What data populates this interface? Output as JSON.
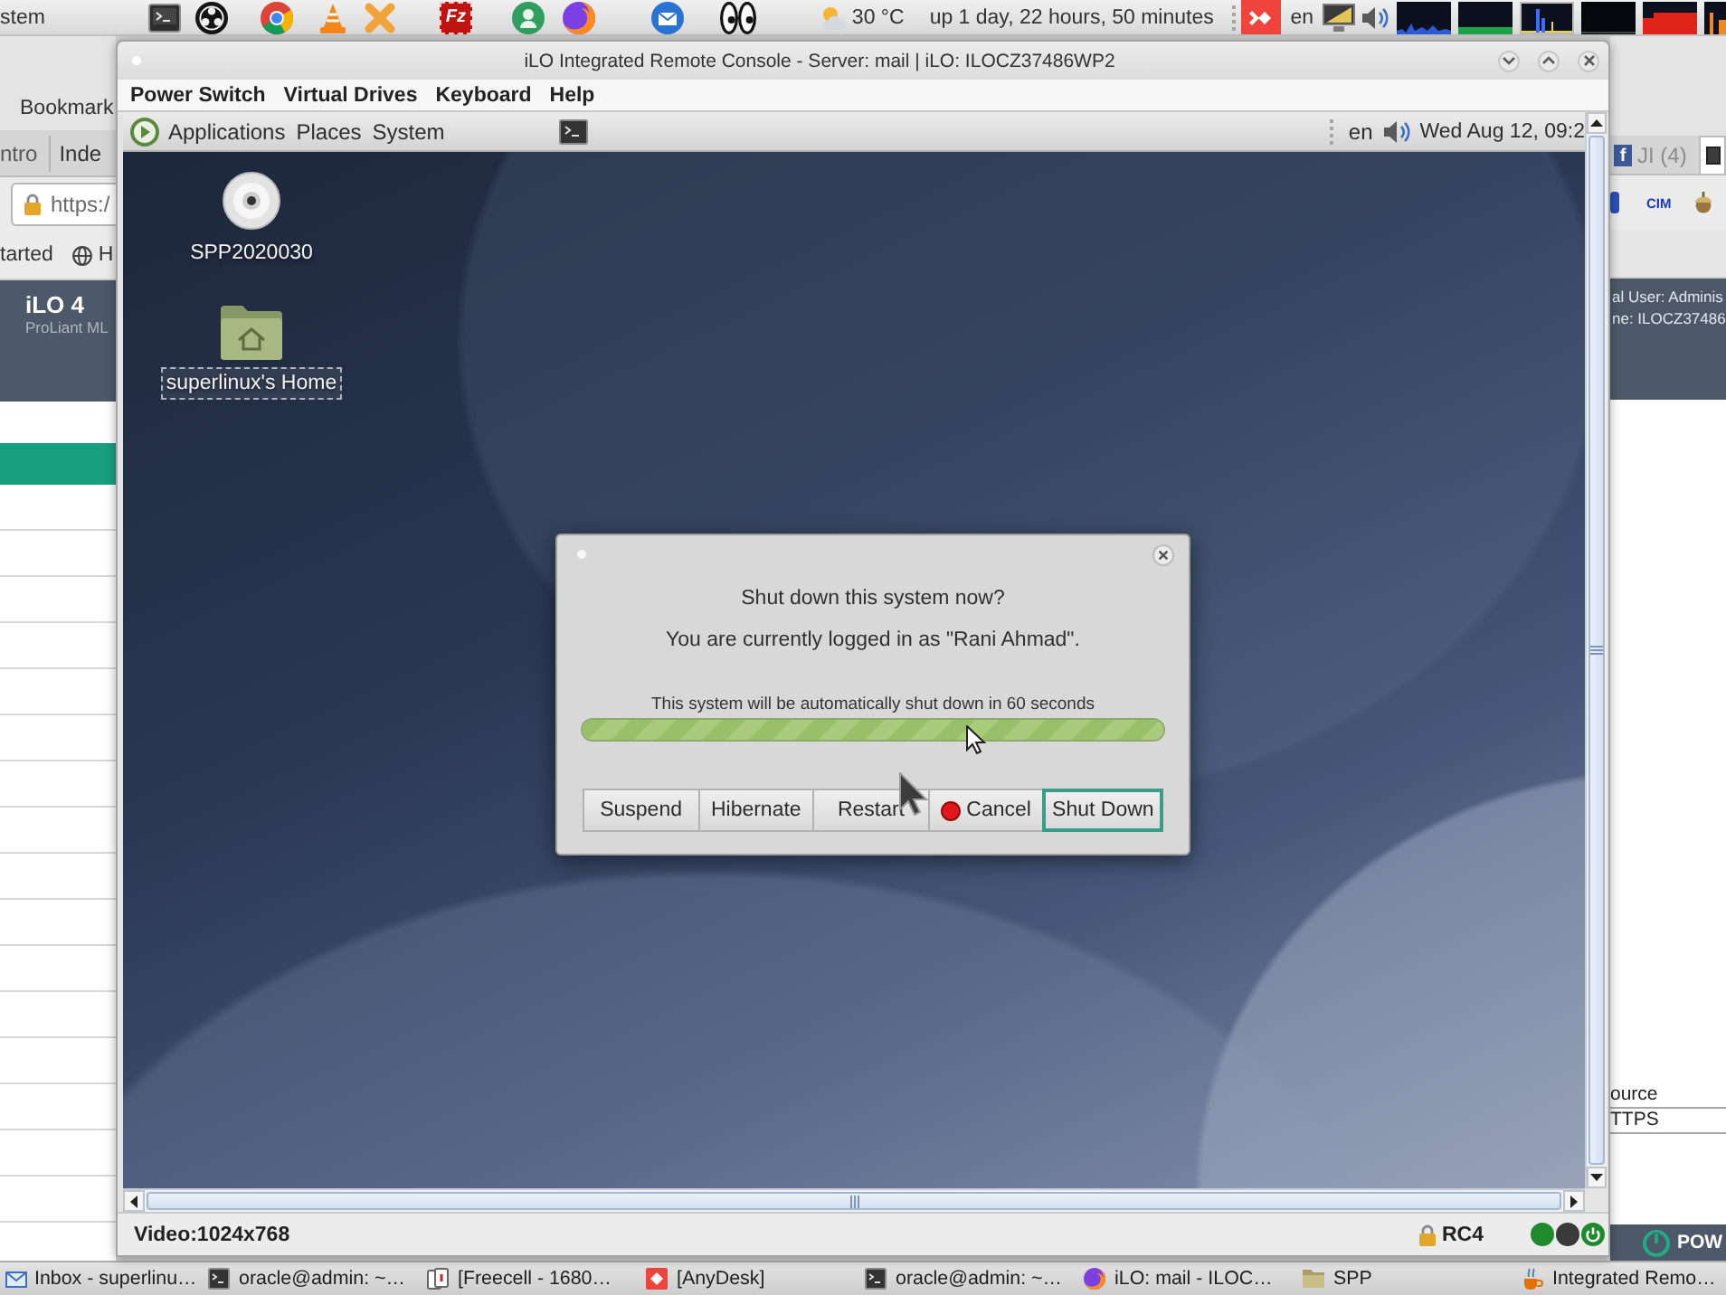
{
  "top_panel": {
    "menu": "stem",
    "launcher_label": "Fz",
    "weather": "30 °C",
    "uptime": "up 1 day, 22 hours, 50 minutes",
    "keyboard_layout": "en"
  },
  "browser": {
    "menu": "Bookmark",
    "tabs": [
      {
        "label": "ntro",
        "selected": false
      },
      {
        "label": "Inde",
        "selected": false
      }
    ],
    "address": "https:/",
    "bookmarks": [
      {
        "label": "tarted",
        "kind": "plain"
      },
      {
        "label": "H",
        "kind": "globe"
      }
    ],
    "header_title": "iLO 4",
    "header_subtitle": "ProLiant ML",
    "right_tabs": [
      {
        "label": "JI (4)",
        "favicon": "f",
        "selected": false
      },
      {
        "selected": true
      }
    ],
    "toolbar_label": "CIM",
    "header_lines": [
      "al User: Adminis",
      "ne: ILOCZ37486"
    ],
    "table_rows": [
      "ource",
      "TTPS"
    ],
    "power_label": "POW"
  },
  "console": {
    "title": "iLO Integrated Remote Console - Server: mail | iLO: ILOCZ37486WP2",
    "menu": [
      "Power Switch",
      "Virtual Drives",
      "Keyboard",
      "Help"
    ],
    "guest_panel": {
      "menus": [
        "Applications",
        "Places",
        "System"
      ],
      "keyboard_layout": "en",
      "clock": "Wed Aug 12, 09:2"
    },
    "desktop_icons": [
      {
        "label": "SPP2020030",
        "kind": "disc",
        "selected": false
      },
      {
        "label": "superlinux's Home",
        "kind": "home-folder",
        "selected": true
      }
    ],
    "dialog": {
      "title": "Shut down this system now?",
      "message": "You are currently logged in as \"Rani Ahmad\".",
      "countdown": {
        "text": "This system will be automatically shut down in 60 seconds",
        "level": 1
      },
      "buttons": [
        {
          "label": "Suspend",
          "kind": "plain",
          "focused": false
        },
        {
          "label": "Hibernate",
          "kind": "plain",
          "focused": false
        },
        {
          "label": "Restart",
          "kind": "plain",
          "focused": false
        },
        {
          "label": "Cancel",
          "kind": "stop",
          "focused": false
        },
        {
          "label": "Shut Down",
          "kind": "plain",
          "focused": true
        }
      ]
    },
    "status": {
      "video": "Video:1024x768",
      "encryption": "RC4",
      "indicators": [
        {
          "kind": "dot",
          "color": "#1e8a2c"
        },
        {
          "kind": "dot",
          "color": "#3a3a3a"
        },
        {
          "kind": "power",
          "color": "#1e8a2c"
        }
      ]
    }
  },
  "taskbar": [
    {
      "label": "Inbox - superlinu…",
      "kind": "mail"
    },
    {
      "label": "oracle@admin: ~…",
      "kind": "terminal"
    },
    {
      "label": "[Freecell - 1680…",
      "kind": "cards"
    },
    {
      "label": "[AnyDesk]",
      "kind": "remote"
    },
    {
      "label": "oracle@admin: ~…",
      "kind": "terminal"
    },
    {
      "label": "iLO: mail - ILOC…",
      "kind": "browser"
    },
    {
      "label": "SPP",
      "kind": "folder"
    },
    {
      "label": "Integrated Remo…",
      "kind": "java"
    }
  ]
}
